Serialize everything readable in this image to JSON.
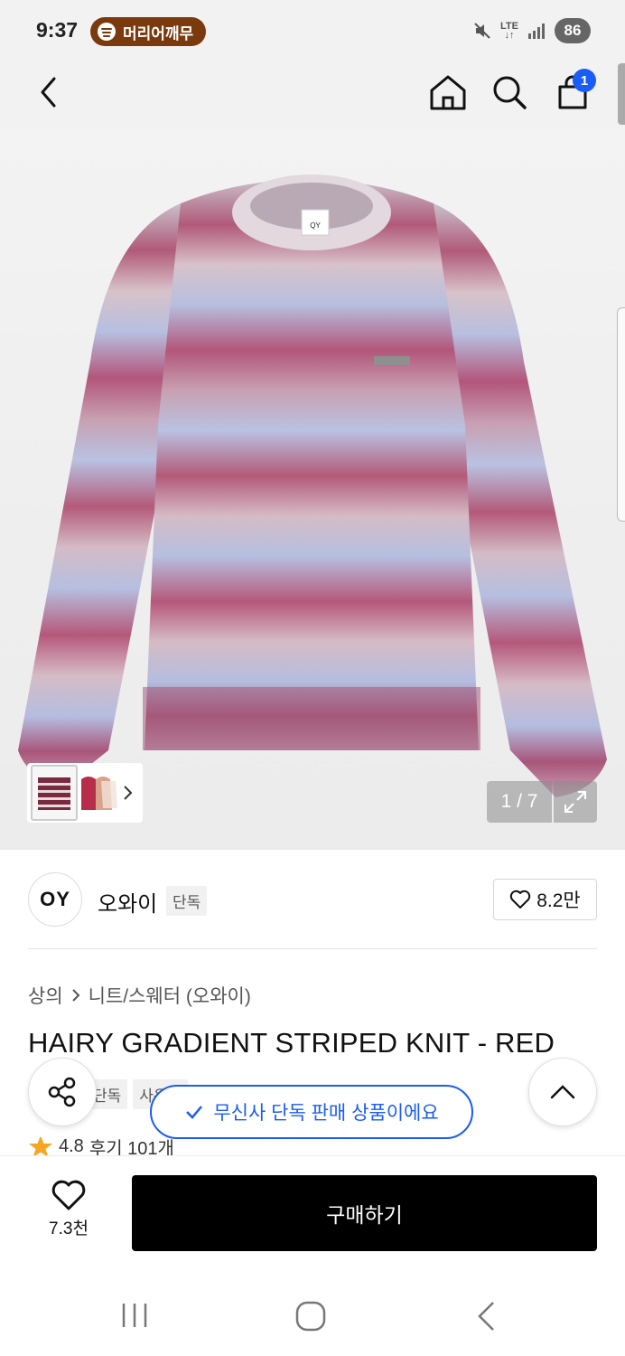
{
  "status_bar": {
    "time": "9:37",
    "music_app": "머리어깨무",
    "network_label": "LTE",
    "battery": "86"
  },
  "header": {
    "back_icon": "chevron-left-icon",
    "home_icon": "home-icon",
    "search_icon": "search-icon",
    "cart_icon": "shopping-bag-icon",
    "cart_badge": "1"
  },
  "gallery": {
    "counter": "1 / 7",
    "expand_icon": "expand-icon",
    "thumb_chevron": "chevron-right-icon"
  },
  "brand": {
    "logo_text": "OY",
    "name": "오와이",
    "tag": "단독",
    "like_count": "8.2만"
  },
  "product": {
    "breadcrumb": [
      "상의",
      "니트/스웨터 (오와이)"
    ],
    "title": "HAIRY GRADIENT STRIPED KNIT - RED",
    "tags": [
      "단독",
      "사은품"
    ],
    "rating": "4.8",
    "reviews": "후기 101개"
  },
  "toast": {
    "text": "무신사 단독 판매 상품이에요"
  },
  "bottom_bar": {
    "wish_count": "7.3천",
    "buy_label": "구매하기"
  },
  "colors": {
    "accent_blue": "#1a5cf5",
    "buy_button": "#000000",
    "music_pill": "#7a3a0e",
    "sweater_rose": "#b25a78",
    "sweater_lavender": "#b8c0e0"
  }
}
